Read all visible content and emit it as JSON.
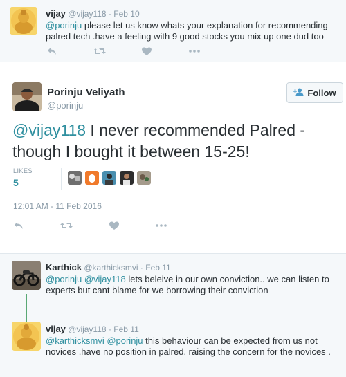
{
  "reply_top": {
    "name": "vijay",
    "handle": "@vijay118",
    "date": "Feb 10",
    "mention": "@porinju",
    "text": " please let us know whats your explanation for recommending palred tech .have a feeling with 9 good stocks you mix up one dud too"
  },
  "main": {
    "name": "Porinju Veliyath",
    "handle": "@porinju",
    "follow_label": "Follow",
    "mention": "@vijay118",
    "text": " I never recommended Palred - though I bought it between 15-25!",
    "likes_label": "LIKES",
    "likes_count": "5",
    "date": "12:01 AM - 11 Feb 2016"
  },
  "replies": [
    {
      "name": "Karthick",
      "handle": "@karthicksmvi",
      "date": "Feb 11",
      "mentions": "@porinju @vijay118",
      "text": " lets beleive in our own conviction.. we can listen to experts but cant blame for we borrowing their conviction"
    },
    {
      "name": "vijay",
      "handle": "@vijay118",
      "date": "Feb 11",
      "mentions": "@karthicksmvi @porinju",
      "text": " this behaviour can be expected from us not novices .have no position in palred. raising the concern for the novices ."
    }
  ],
  "icons": {
    "reply": "reply-icon",
    "retweet": "retweet-icon",
    "like": "heart-icon",
    "more": "more-icon",
    "follow": "add-user-icon"
  },
  "colors": {
    "link": "#2f8f9f",
    "muted": "#8899a6",
    "icon": "#aab8c2",
    "thread_line": "#5aa874"
  }
}
